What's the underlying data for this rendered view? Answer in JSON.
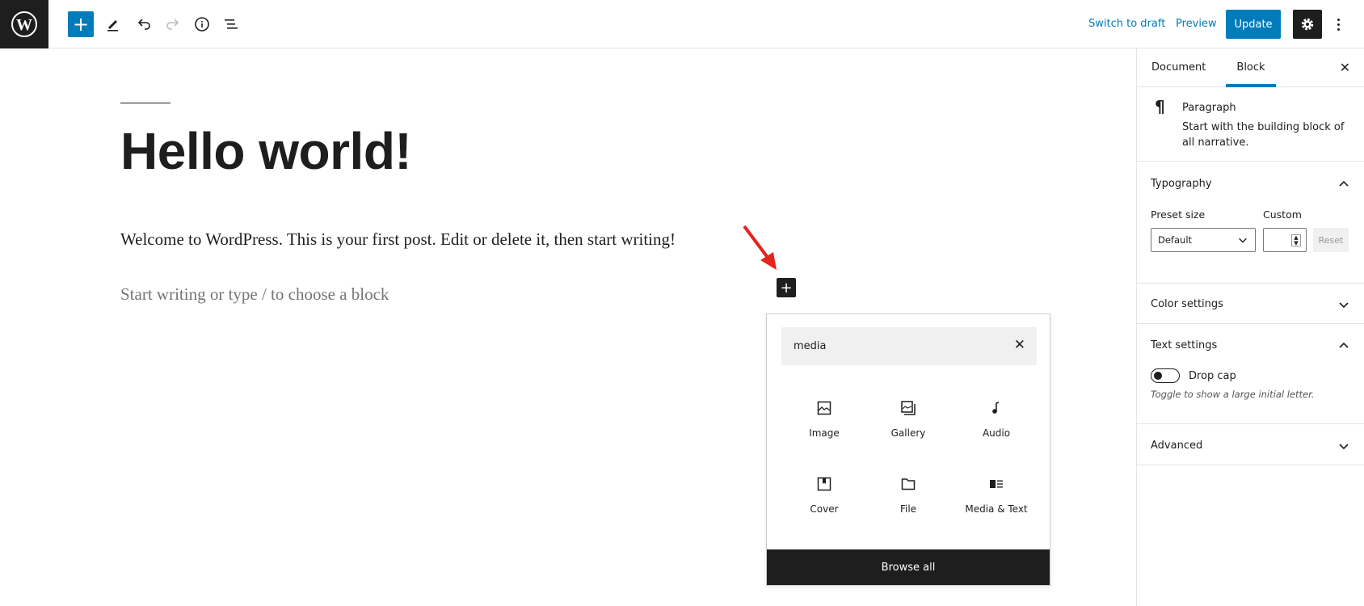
{
  "header": {
    "switch_to_draft": "Switch to draft",
    "preview": "Preview",
    "update": "Update"
  },
  "editor": {
    "title": "Hello world!",
    "paragraph": "Welcome to WordPress. This is your first post. Edit or delete it, then start writing!",
    "placeholder": "Start writing or type / to choose a block"
  },
  "inserter": {
    "search_value": "media",
    "blocks": [
      {
        "label": "Image",
        "icon": "image-icon"
      },
      {
        "label": "Gallery",
        "icon": "gallery-icon"
      },
      {
        "label": "Audio",
        "icon": "audio-icon"
      },
      {
        "label": "Cover",
        "icon": "cover-icon"
      },
      {
        "label": "File",
        "icon": "file-icon"
      },
      {
        "label": "Media & Text",
        "icon": "media-text-icon"
      }
    ],
    "browse_all": "Browse all"
  },
  "sidebar": {
    "tabs": [
      {
        "label": "Document"
      },
      {
        "label": "Block",
        "active": true
      }
    ],
    "block_name": "Paragraph",
    "block_desc": "Start with the building block of all narrative.",
    "typography": {
      "title": "Typography",
      "preset_label": "Preset size",
      "custom_label": "Custom",
      "preset_value": "Default",
      "reset": "Reset"
    },
    "color_settings": "Color settings",
    "text_settings": {
      "title": "Text settings",
      "drop_cap": "Drop cap",
      "drop_cap_on": false,
      "help": "Toggle to show a large initial letter."
    },
    "advanced": "Advanced"
  },
  "colors": {
    "accent": "#007cba",
    "dark": "#1e1e1e",
    "annotation_arrow": "#e8231b"
  }
}
